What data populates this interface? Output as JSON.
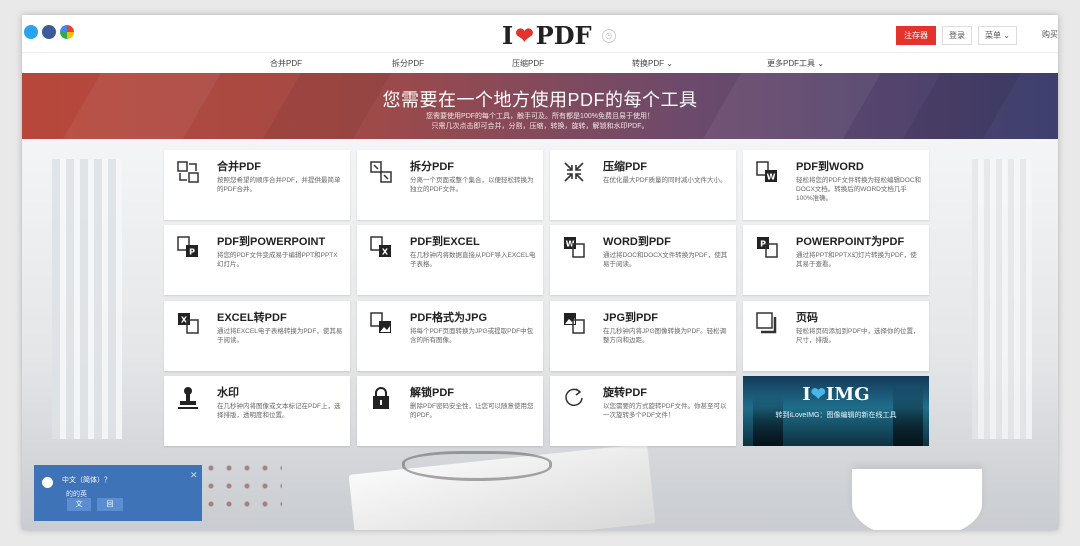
{
  "header": {
    "social_icons": [
      "twitter-icon",
      "facebook-icon",
      "google-plus-icon"
    ],
    "logo_left": "I",
    "logo_heart": "❤",
    "logo_right": "PDF",
    "save_label": "注存器",
    "login_label": "登录",
    "menu_label": "菜单 ⌄",
    "cut_label": "购买"
  },
  "nav": {
    "items": [
      "合并PDF",
      "拆分PDF",
      "压缩PDF",
      "转换PDF ⌄",
      "更多PDF工具 ⌄"
    ]
  },
  "hero": {
    "title": "您需要在一个地方使用PDF的每个工具",
    "line1": "您需要使用PDF的每个工具，触手可及。所有都是100%免费且易于使用！",
    "line2": "只需几次点击即可合并，分割，压缩，转换，旋转，解锁和水印PDF。"
  },
  "tools": [
    {
      "title": "合并PDF",
      "desc": "按照您希望的顺序合并PDF，并提供最简单的PDF合并。"
    },
    {
      "title": "拆分PDF",
      "desc": "分离一个页面或整个集合，以便轻松转换为独立的PDF文件。"
    },
    {
      "title": "压缩PDF",
      "desc": "在优化最大PDF质量的同时减小文件大小。"
    },
    {
      "title": "PDF到WORD",
      "desc": "轻松将您的PDF文件转换为轻松编辑DOC和DOCX文档。转换后的WORD文档几乎100%准确。"
    },
    {
      "title": "PDF到POWERPOINT",
      "desc": "将您的PDF文件变成易于编辑PPT和PPTX幻灯片。"
    },
    {
      "title": "PDF到EXCEL",
      "desc": "在几秒钟内将数据直接从PDF导入EXCEL电子表格。"
    },
    {
      "title": "WORD到PDF",
      "desc": "通过将DOC和DOCX文件转换为PDF，使其易于阅读。"
    },
    {
      "title": "POWERPOINT为PDF",
      "desc": "通过将PPT和PPTX幻灯片转换为PDF，使其易于查看。"
    },
    {
      "title": "EXCEL转PDF",
      "desc": "通过将EXCEL电子表格转换为PDF，使其易于阅读。"
    },
    {
      "title": "PDF格式为JPG",
      "desc": "将每个PDF页面转换为JPG或提取PDF中包含的所有图像。"
    },
    {
      "title": "JPG到PDF",
      "desc": "在几秒钟内将JPG图像转换为PDF。轻松调整方向和边距。"
    },
    {
      "title": "页码",
      "desc": "轻松将页码添加到PDF中，选择你的位置，尺寸，排版。"
    },
    {
      "title": "水印",
      "desc": "在几秒钟内将图像或文本标记在PDF上，选择排版，透明度和位置。"
    },
    {
      "title": "解锁PDF",
      "desc": "删除PDF密码安全性，让您可以随意使用您的PDF。"
    },
    {
      "title": "旋转PDF",
      "desc": "以您需要的方式旋转PDF文件。你甚至可以一次旋转多个PDF文件！"
    }
  ],
  "promo": {
    "logo_left": "I",
    "logo_heart": "❤",
    "logo_right": "IMG",
    "tagline": "转到iLoveIMG：图像编辑的新在线工具"
  },
  "language_popup": {
    "question": "中文（简体）？",
    "subtitle": "的的英",
    "btn_yes": "文",
    "btn_no": "回",
    "close": "✕"
  },
  "colors": {
    "brand_red": "#e5322d",
    "hero_start": "#b8473a",
    "hero_end": "#3e3f6e",
    "popup_blue": "#3f73b8"
  }
}
